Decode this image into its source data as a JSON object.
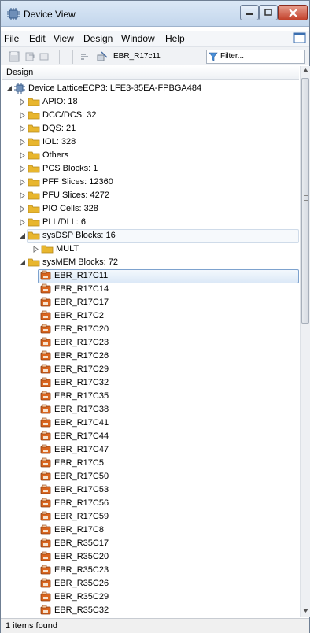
{
  "window": {
    "title": "Device View"
  },
  "menu": [
    "File",
    "Edit",
    "View",
    "Design",
    "Window",
    "Help"
  ],
  "toolbar": {
    "design_value": "EBR_R17c11",
    "filter_placeholder": "Filter..."
  },
  "header": {
    "title": "Design"
  },
  "tree": {
    "root": "Device LatticeECP3: LFE3-35EA-FPBGA484",
    "folders": [
      "APIO: 18",
      "DCC/DCS: 32",
      "DQS: 21",
      "IOL: 328",
      "Others",
      "PCS Blocks: 1",
      "PFF Slices: 12360",
      "PFU Slices: 4272",
      "PIO Cells: 328",
      "PLL/DLL: 6"
    ],
    "sysdsp": {
      "label": "sysDSP Blocks: 16",
      "child": "MULT"
    },
    "sysmem": {
      "label": "sysMEM Blocks: 72",
      "items": [
        "EBR_R17C11",
        "EBR_R17C14",
        "EBR_R17C17",
        "EBR_R17C2",
        "EBR_R17C20",
        "EBR_R17C23",
        "EBR_R17C26",
        "EBR_R17C29",
        "EBR_R17C32",
        "EBR_R17C35",
        "EBR_R17C38",
        "EBR_R17C41",
        "EBR_R17C44",
        "EBR_R17C47",
        "EBR_R17C5",
        "EBR_R17C50",
        "EBR_R17C53",
        "EBR_R17C56",
        "EBR_R17C59",
        "EBR_R17C8",
        "EBR_R35C17",
        "EBR_R35C20",
        "EBR_R35C23",
        "EBR_R35C26",
        "EBR_R35C29",
        "EBR_R35C32"
      ]
    }
  },
  "status": {
    "text": "1 items found"
  },
  "colors": {
    "folder": "#e8b62e",
    "ebr": "#d8641e",
    "selection_border": "#7da2ce"
  }
}
